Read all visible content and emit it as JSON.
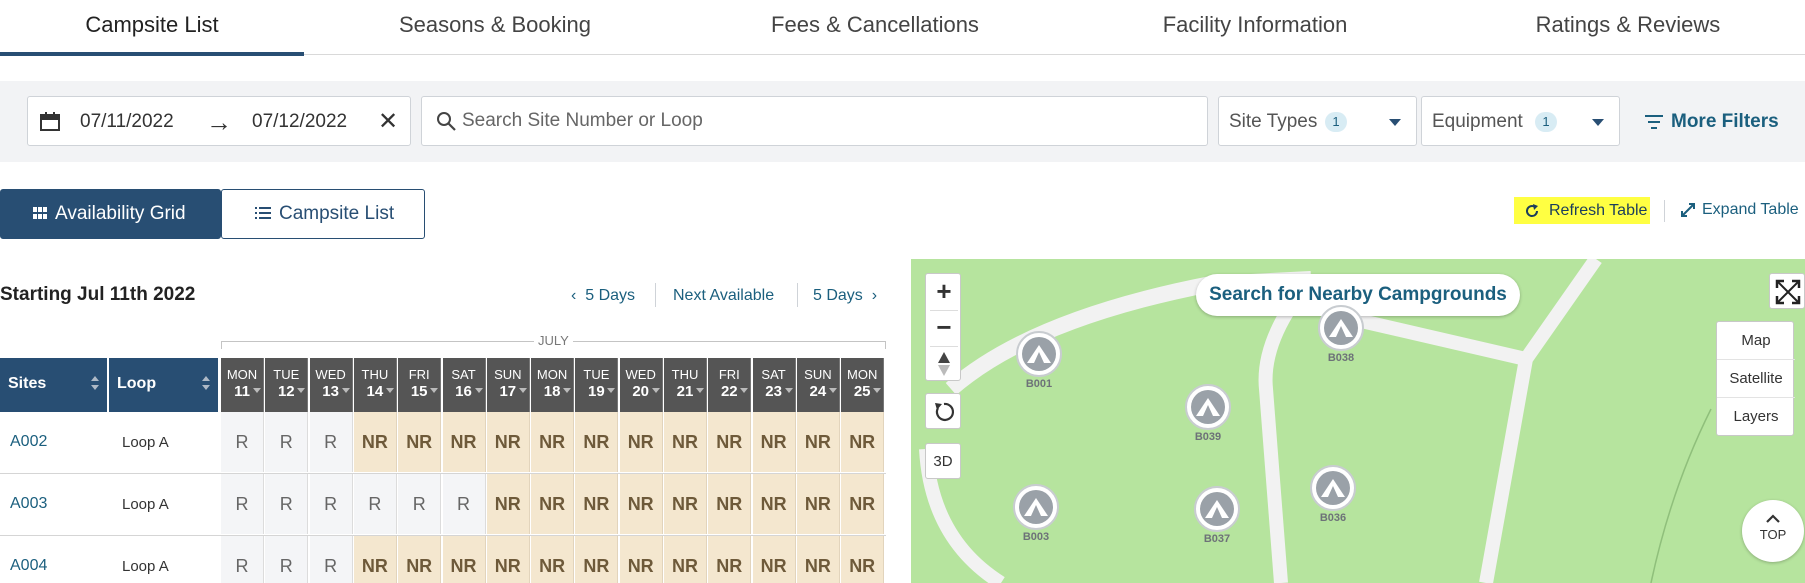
{
  "tabs": [
    {
      "label": "Campsite List"
    },
    {
      "label": "Seasons & Booking"
    },
    {
      "label": "Fees & Cancellations"
    },
    {
      "label": "Facility Information"
    },
    {
      "label": "Ratings & Reviews"
    }
  ],
  "filters": {
    "date_start": "07/11/2022",
    "date_end": "07/12/2022",
    "arrow": "→",
    "clear": "✕",
    "search_placeholder": "Search Site Number or Loop",
    "site_types_label": "Site Types",
    "site_types_count": "1",
    "equipment_label": "Equipment",
    "equipment_count": "1",
    "more_filters_label": "More Filters"
  },
  "view_toggle": {
    "grid_label": "Availability Grid",
    "list_label": "Campsite List"
  },
  "actions": {
    "refresh_label": "Refresh Table",
    "expand_label": "Expand Table",
    "highlight_color": "#ffff42"
  },
  "grid": {
    "starting_label": "Starting Jul 11th 2022",
    "prev_label": "5 Days",
    "next_available_label": "Next Available",
    "next_label": "5 Days",
    "month": "JULY",
    "site_header": "Sites",
    "loop_header": "Loop",
    "days": [
      {
        "dow": "MON",
        "day": "11"
      },
      {
        "dow": "TUE",
        "day": "12"
      },
      {
        "dow": "WED",
        "day": "13"
      },
      {
        "dow": "THU",
        "day": "14"
      },
      {
        "dow": "FRI",
        "day": "15"
      },
      {
        "dow": "SAT",
        "day": "16"
      },
      {
        "dow": "SUN",
        "day": "17"
      },
      {
        "dow": "MON",
        "day": "18"
      },
      {
        "dow": "TUE",
        "day": "19"
      },
      {
        "dow": "WED",
        "day": "20"
      },
      {
        "dow": "THU",
        "day": "21"
      },
      {
        "dow": "FRI",
        "day": "22"
      },
      {
        "dow": "SAT",
        "day": "23"
      },
      {
        "dow": "SUN",
        "day": "24"
      },
      {
        "dow": "MON",
        "day": "25"
      }
    ],
    "rows": [
      {
        "site": "A002",
        "loop": "Loop A",
        "cells": [
          "R",
          "R",
          "R",
          "NR",
          "NR",
          "NR",
          "NR",
          "NR",
          "NR",
          "NR",
          "NR",
          "NR",
          "NR",
          "NR",
          "NR"
        ]
      },
      {
        "site": "A003",
        "loop": "Loop A",
        "cells": [
          "R",
          "R",
          "R",
          "R",
          "R",
          "R",
          "NR",
          "NR",
          "NR",
          "NR",
          "NR",
          "NR",
          "NR",
          "NR",
          "NR"
        ]
      },
      {
        "site": "A004",
        "loop": "Loop A",
        "cells": [
          "R",
          "R",
          "R",
          "NR",
          "NR",
          "NR",
          "NR",
          "NR",
          "NR",
          "NR",
          "NR",
          "NR",
          "NR",
          "NR",
          "NR"
        ]
      }
    ]
  },
  "map": {
    "search_nearby_label": "Search for Nearby Campgrounds",
    "zoom_in": "+",
    "zoom_out": "−",
    "three_d_label": "3D",
    "layers": [
      "Map",
      "Satellite",
      "Layers"
    ],
    "top_label": "TOP",
    "pins": [
      "B001",
      "B038",
      "B039",
      "B003",
      "B037",
      "B036"
    ]
  }
}
